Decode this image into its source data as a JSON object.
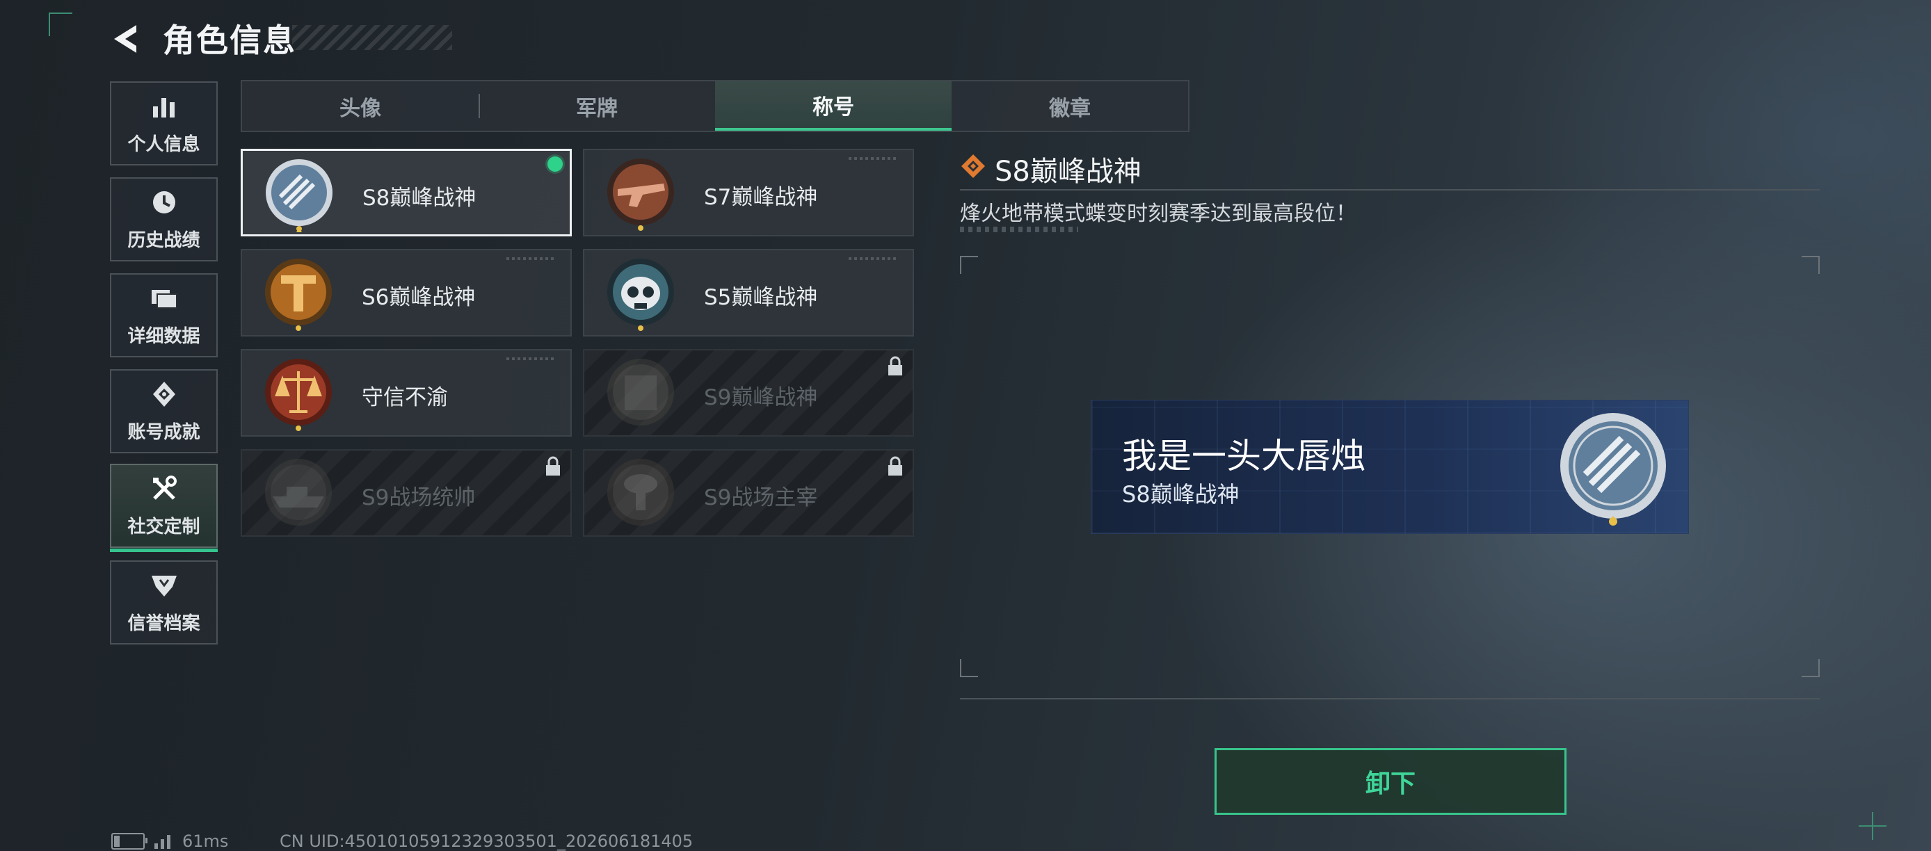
{
  "header": {
    "title": "角色信息"
  },
  "sidebar": {
    "items": [
      {
        "label": "个人信息",
        "icon": "bar-chart-icon",
        "active": false
      },
      {
        "label": "历史战绩",
        "icon": "history-clock-icon",
        "active": false
      },
      {
        "label": "详细数据",
        "icon": "folder-icon",
        "active": false
      },
      {
        "label": "账号成就",
        "icon": "achievement-icon",
        "active": false
      },
      {
        "label": "社交定制",
        "icon": "tools-icon",
        "active": true
      },
      {
        "label": "信誉档案",
        "icon": "reputation-icon",
        "active": false
      }
    ]
  },
  "tabs": [
    {
      "label": "头像",
      "active": false
    },
    {
      "label": "军牌",
      "active": false
    },
    {
      "label": "称号",
      "active": true
    },
    {
      "label": "徽章",
      "active": false
    }
  ],
  "titles": [
    {
      "name": "S8巅峰战神",
      "selected": true,
      "equipped": true,
      "locked": false,
      "badge_color": "#5f7f9c"
    },
    {
      "name": "S7巅峰战神",
      "selected": false,
      "equipped": false,
      "locked": false,
      "badge_color": "#8a4a32"
    },
    {
      "name": "S6巅峰战神",
      "selected": false,
      "equipped": false,
      "locked": false,
      "badge_color": "#b06a22"
    },
    {
      "name": "S5巅峰战神",
      "selected": false,
      "equipped": false,
      "locked": false,
      "badge_color": "#3f6b78"
    },
    {
      "name": "守信不渝",
      "selected": false,
      "equipped": false,
      "locked": false,
      "badge_color": "#9a3a26"
    },
    {
      "name": "S9巅峰战神",
      "selected": false,
      "equipped": false,
      "locked": true,
      "badge_color": "#6a6050"
    },
    {
      "name": "S9战场统帅",
      "selected": false,
      "equipped": false,
      "locked": true,
      "badge_color": "#5a5a50"
    },
    {
      "name": "S9战场主宰",
      "selected": false,
      "equipped": false,
      "locked": true,
      "badge_color": "#6a5848"
    }
  ],
  "detail": {
    "title": "S8巅峰战神",
    "description": "烽火地带模式蝶变时刻赛季达到最高段位！"
  },
  "preview": {
    "player_name": "我是一头大唇烛",
    "title": "S8巅峰战神"
  },
  "actions": {
    "unequip_label": "卸下"
  },
  "footer": {
    "ping": "61ms",
    "uid": "CN UID:45010105912329303501_202606181405"
  },
  "colors": {
    "accent": "#35c48e",
    "card_bg": "#30363c",
    "preview_bg": "#1e3054"
  }
}
